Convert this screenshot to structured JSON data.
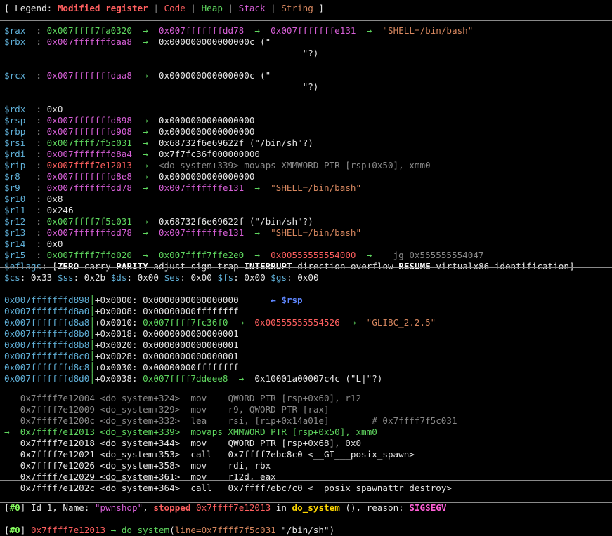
{
  "legend": {
    "open": "[ Legend: ",
    "modified": "Modified register",
    "code": "Code",
    "heap": "Heap",
    "stack": "Stack",
    "string": "String",
    "close": " ]",
    "pipe": " | "
  },
  "arrow": "→",
  "registers": [
    {
      "name": "$rax",
      "chain": [
        {
          "v": "0x007ffff7fa0320",
          "c": "g"
        },
        {
          "v": "0x007fffffffdd78",
          "c": "m"
        },
        {
          "v": "0x007fffffffe131",
          "c": "m"
        },
        {
          "v": "\"SHELL=/bin/bash\"",
          "c": "o"
        }
      ]
    },
    {
      "name": "$rbx",
      "chain": [
        {
          "v": "0x007fffffffdaa8",
          "c": "m"
        },
        {
          "v": "0x000000000000000c (\"",
          "c": "w"
        }
      ],
      "cont": "\"?)"
    },
    {
      "name": "$rcx",
      "chain": [
        {
          "v": "0x007fffffffdaa8",
          "c": "m"
        },
        {
          "v": "0x000000000000000c (\"",
          "c": "w"
        }
      ],
      "cont": "\"?)"
    },
    {
      "name": "$rdx",
      "chain": [
        {
          "v": "0x0",
          "c": "w"
        }
      ]
    },
    {
      "name": "$rsp",
      "chain": [
        {
          "v": "0x007fffffffd898",
          "c": "m"
        },
        {
          "v": "0x0000000000000000",
          "c": "w"
        }
      ]
    },
    {
      "name": "$rbp",
      "chain": [
        {
          "v": "0x007fffffffd908",
          "c": "m"
        },
        {
          "v": "0x0000000000000000",
          "c": "w"
        }
      ]
    },
    {
      "name": "$rsi",
      "chain": [
        {
          "v": "0x007ffff7f5c031",
          "c": "g"
        },
        {
          "v": "0x68732f6e69622f (\"/bin/sh\"?)",
          "c": "w"
        }
      ]
    },
    {
      "name": "$rdi",
      "chain": [
        {
          "v": "0x007fffffffd8a4",
          "c": "m"
        },
        {
          "v": "0x7f7fc36f000000000",
          "c": "w"
        }
      ]
    },
    {
      "name": "$rip",
      "chain": [
        {
          "v": "0x007ffff7e12013",
          "c": "r"
        },
        {
          "v": "<do_system+339> movaps XMMWORD PTR [rsp+0x50], xmm0",
          "c": "gray"
        }
      ]
    },
    {
      "name": "$r8",
      "chain": [
        {
          "v": "0x007fffffffd8e8",
          "c": "m"
        },
        {
          "v": "0x0000000000000000",
          "c": "w"
        }
      ]
    },
    {
      "name": "$r9",
      "chain": [
        {
          "v": "0x007fffffffdd78",
          "c": "m"
        },
        {
          "v": "0x007fffffffe131",
          "c": "m"
        },
        {
          "v": "\"SHELL=/bin/bash\"",
          "c": "o"
        }
      ]
    },
    {
      "name": "$r10",
      "chain": [
        {
          "v": "0x8",
          "c": "w"
        }
      ]
    },
    {
      "name": "$r11",
      "chain": [
        {
          "v": "0x246",
          "c": "w"
        }
      ]
    },
    {
      "name": "$r12",
      "chain": [
        {
          "v": "0x007ffff7f5c031",
          "c": "g"
        },
        {
          "v": "0x68732f6e69622f (\"/bin/sh\"?)",
          "c": "w"
        }
      ]
    },
    {
      "name": "$r13",
      "chain": [
        {
          "v": "0x007fffffffdd78",
          "c": "m"
        },
        {
          "v": "0x007fffffffe131",
          "c": "m"
        },
        {
          "v": "\"SHELL=/bin/bash\"",
          "c": "o"
        }
      ]
    },
    {
      "name": "$r14",
      "chain": [
        {
          "v": "0x0",
          "c": "w"
        }
      ]
    },
    {
      "name": "$r15",
      "chain": [
        {
          "v": "0x007ffff7ffd020",
          "c": "g"
        },
        {
          "v": "0x007ffff7ffe2e0",
          "c": "g"
        },
        {
          "v": "0x00555555554000",
          "c": "r"
        },
        {
          "v": "  jg 0x555555554047",
          "c": "gray"
        }
      ]
    }
  ],
  "eflags": {
    "label": "$eflags",
    "flags": [
      {
        "t": "ZERO",
        "on": true
      },
      {
        "t": "carry",
        "on": false
      },
      {
        "t": "PARITY",
        "on": true
      },
      {
        "t": "adjust",
        "on": false
      },
      {
        "t": "sign",
        "on": false
      },
      {
        "t": "trap",
        "on": false
      },
      {
        "t": "INTERRUPT",
        "on": true
      },
      {
        "t": "direction",
        "on": false
      },
      {
        "t": "overflow",
        "on": false
      },
      {
        "t": "RESUME",
        "on": true
      },
      {
        "t": "virtualx86",
        "on": false
      },
      {
        "t": "identification",
        "on": false
      }
    ]
  },
  "segments": [
    {
      "n": "$cs",
      "v": "0x33"
    },
    {
      "n": "$ss",
      "v": "0x2b"
    },
    {
      "n": "$ds",
      "v": "0x00"
    },
    {
      "n": "$es",
      "v": "0x00"
    },
    {
      "n": "$fs",
      "v": "0x00"
    },
    {
      "n": "$gs",
      "v": "0x00"
    }
  ],
  "stack": [
    {
      "addr": "0x007fffffffd898",
      "off": "+0x0000",
      "chain": [
        {
          "v": "0x0000000000000000",
          "c": "w"
        }
      ],
      "tag": "← $rsp"
    },
    {
      "addr": "0x007fffffffd8a0",
      "off": "+0x0008",
      "chain": [
        {
          "v": "0x00000000ffffffff",
          "c": "w"
        }
      ]
    },
    {
      "addr": "0x007fffffffd8a8",
      "off": "+0x0010",
      "chain": [
        {
          "v": "0x007ffff7fc36f0",
          "c": "g"
        },
        {
          "v": "0x00555555554526",
          "c": "r"
        },
        {
          "v": "\"GLIBC_2.2.5\"",
          "c": "o"
        }
      ]
    },
    {
      "addr": "0x007fffffffd8b0",
      "off": "+0x0018",
      "chain": [
        {
          "v": "0x0000000000000001",
          "c": "w"
        }
      ]
    },
    {
      "addr": "0x007fffffffd8b8",
      "off": "+0x0020",
      "chain": [
        {
          "v": "0x0000000000000001",
          "c": "w"
        }
      ]
    },
    {
      "addr": "0x007fffffffd8c0",
      "off": "+0x0028",
      "chain": [
        {
          "v": "0x0000000000000001",
          "c": "w"
        }
      ]
    },
    {
      "addr": "0x007fffffffd8c8",
      "off": "+0x0030",
      "chain": [
        {
          "v": "0x00000000ffffffff",
          "c": "w"
        }
      ]
    },
    {
      "addr": "0x007fffffffd8d0",
      "off": "+0x0038",
      "chain": [
        {
          "v": "0x007ffff7ddeee8",
          "c": "g"
        },
        {
          "v": "0x10001a00007c4c (\"L|\"?)",
          "c": "w"
        }
      ]
    }
  ],
  "code": [
    {
      "mark": " ",
      "addr": "0x7ffff7e12004",
      "sym": "<do_system+324>",
      "mn": "mov",
      "ops": "QWORD PTR [rsp+0x60], r12",
      "st": "past"
    },
    {
      "mark": " ",
      "addr": "0x7ffff7e12009",
      "sym": "<do_system+329>",
      "mn": "mov",
      "ops": "r9, QWORD PTR [rax]",
      "st": "past"
    },
    {
      "mark": " ",
      "addr": "0x7ffff7e1200c",
      "sym": "<do_system+332>",
      "mn": "lea",
      "ops": "rsi, [rip+0x14a01e]        # 0x7ffff7f5c031",
      "st": "past"
    },
    {
      "mark": "→",
      "addr": "0x7ffff7e12013",
      "sym": "<do_system+339>",
      "mn": "movaps",
      "ops": "XMMWORD PTR [rsp+0x50], xmm0",
      "st": "cur"
    },
    {
      "mark": " ",
      "addr": "0x7ffff7e12018",
      "sym": "<do_system+344>",
      "mn": "mov",
      "ops": "QWORD PTR [rsp+0x68], 0x0",
      "st": "next"
    },
    {
      "mark": " ",
      "addr": "0x7ffff7e12021",
      "sym": "<do_system+353>",
      "mn": "call",
      "ops": "0x7ffff7ebc8c0 <__GI___posix_spawn>",
      "st": "next"
    },
    {
      "mark": " ",
      "addr": "0x7ffff7e12026",
      "sym": "<do_system+358>",
      "mn": "mov",
      "ops": "rdi, rbx",
      "st": "next"
    },
    {
      "mark": " ",
      "addr": "0x7ffff7e12029",
      "sym": "<do_system+361>",
      "mn": "mov",
      "ops": "r12d, eax",
      "st": "next"
    },
    {
      "mark": " ",
      "addr": "0x7ffff7e1202c",
      "sym": "<do_system+364>",
      "mn": "call",
      "ops": "0x7ffff7ebc7c0 <__posix_spawnattr_destroy>",
      "st": "next"
    }
  ],
  "threads": {
    "idx": "#0",
    "prefix": " Id 1, Name: ",
    "name": "\"pwnshop\"",
    "state": "stopped",
    "addr": "0x7ffff7e12013",
    "in": " in ",
    "func": "do_system",
    "suffix": " (), reason: ",
    "reason": "SIGSEGV"
  },
  "trace": {
    "idx": "#0",
    "addr": "0x7ffff7e12013",
    "func": "do_system",
    "arg": "line=0x7ffff7f5c031",
    "str": " \"/bin/sh\")"
  }
}
